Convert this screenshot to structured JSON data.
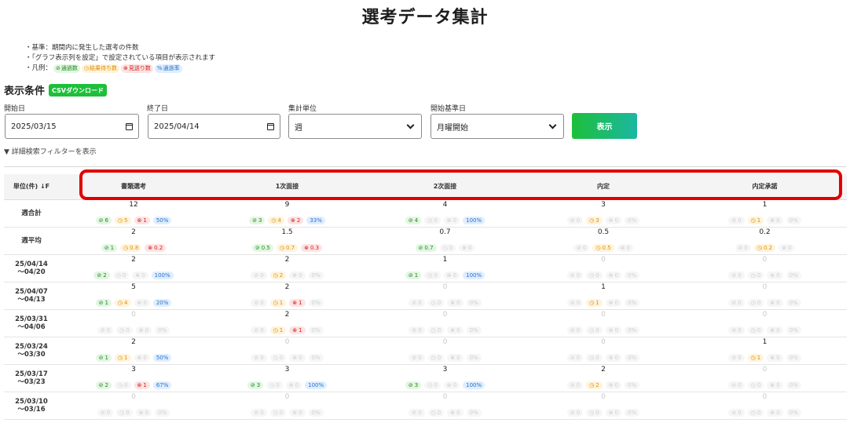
{
  "title": "選考データ集計",
  "notes": {
    "line1": "・基準：期間内に発生した選考の件数",
    "line2": "・「グラフ表示列を設定」で設定されている項目が表示されます",
    "legend_prefix": "・凡例：",
    "legend": [
      {
        "icon": "⊘",
        "label": "通過数",
        "kind": "g"
      },
      {
        "icon": "◷",
        "label": "結果待ち数",
        "kind": "o"
      },
      {
        "icon": "⊗",
        "label": "見送り数",
        "kind": "r"
      },
      {
        "icon": "%",
        "label": "通過率",
        "kind": "b"
      }
    ]
  },
  "conditions": {
    "title": "表示条件",
    "csv_label": "CSVダウンロード",
    "start_label": "開始日",
    "start_value": "2025/03/15",
    "end_label": "終了日",
    "end_value": "2025/04/14",
    "unit_label": "集計単位",
    "unit_value": "週",
    "base_label": "開始基準日",
    "base_value": "月曜開始",
    "show_label": "表示",
    "filter_toggle": "▼ 詳細検索フィルターを表示"
  },
  "table": {
    "corner_label": "単位(件)",
    "sort_icon": "↓F",
    "columns": [
      "書類選考",
      "1次面接",
      "2次面接",
      "内定",
      "内定承諾"
    ],
    "rows": [
      {
        "label1": "週合計",
        "label2": "",
        "cells": [
          {
            "v": "12",
            "p": "6",
            "w": "5",
            "f": "1",
            "r": "50%"
          },
          {
            "v": "9",
            "p": "3",
            "w": "4",
            "f": "2",
            "r": "33%"
          },
          {
            "v": "4",
            "p": "4",
            "w": "0",
            "f": "0",
            "r": "100%"
          },
          {
            "v": "3",
            "p": "0",
            "w": "3",
            "f": "0",
            "r": "0%"
          },
          {
            "v": "1",
            "p": "0",
            "w": "1",
            "f": "0",
            "r": "0%"
          }
        ]
      },
      {
        "label1": "週平均",
        "label2": "",
        "cells": [
          {
            "v": "2",
            "p": "1",
            "w": "0.8",
            "f": "0.2",
            "r": ""
          },
          {
            "v": "1.5",
            "p": "0.5",
            "w": "0.7",
            "f": "0.3",
            "r": ""
          },
          {
            "v": "0.7",
            "p": "0.7",
            "w": "0",
            "f": "0",
            "r": ""
          },
          {
            "v": "0.5",
            "p": "0",
            "w": "0.5",
            "f": "0",
            "r": ""
          },
          {
            "v": "0.2",
            "p": "0",
            "w": "0.2",
            "f": "0",
            "r": ""
          }
        ]
      },
      {
        "label1": "25/04/14",
        "label2": "〜04/20",
        "cells": [
          {
            "v": "2",
            "p": "2",
            "w": "0",
            "f": "0",
            "r": "100%"
          },
          {
            "v": "2",
            "p": "0",
            "w": "2",
            "f": "0",
            "r": "0%"
          },
          {
            "v": "1",
            "p": "1",
            "w": "0",
            "f": "0",
            "r": "100%"
          },
          {
            "v": "0",
            "p": "0",
            "w": "0",
            "f": "0",
            "r": "0%"
          },
          {
            "v": "0",
            "p": "0",
            "w": "0",
            "f": "0",
            "r": "0%"
          }
        ]
      },
      {
        "label1": "25/04/07",
        "label2": "〜04/13",
        "cells": [
          {
            "v": "5",
            "p": "1",
            "w": "4",
            "f": "0",
            "r": "20%"
          },
          {
            "v": "2",
            "p": "0",
            "w": "1",
            "f": "1",
            "r": "0%"
          },
          {
            "v": "0",
            "p": "0",
            "w": "0",
            "f": "0",
            "r": "0%"
          },
          {
            "v": "1",
            "p": "0",
            "w": "1",
            "f": "0",
            "r": "0%"
          },
          {
            "v": "0",
            "p": "0",
            "w": "0",
            "f": "0",
            "r": "0%"
          }
        ]
      },
      {
        "label1": "25/03/31",
        "label2": "〜04/06",
        "cells": [
          {
            "v": "0",
            "p": "0",
            "w": "0",
            "f": "0",
            "r": "0%"
          },
          {
            "v": "2",
            "p": "0",
            "w": "1",
            "f": "1",
            "r": "0%"
          },
          {
            "v": "0",
            "p": "0",
            "w": "0",
            "f": "0",
            "r": "0%"
          },
          {
            "v": "0",
            "p": "0",
            "w": "0",
            "f": "0",
            "r": "0%"
          },
          {
            "v": "0",
            "p": "0",
            "w": "0",
            "f": "0",
            "r": "0%"
          }
        ]
      },
      {
        "label1": "25/03/24",
        "label2": "〜03/30",
        "cells": [
          {
            "v": "2",
            "p": "1",
            "w": "1",
            "f": "0",
            "r": "50%"
          },
          {
            "v": "0",
            "p": "0",
            "w": "0",
            "f": "0",
            "r": "0%"
          },
          {
            "v": "0",
            "p": "0",
            "w": "0",
            "f": "0",
            "r": "0%"
          },
          {
            "v": "0",
            "p": "0",
            "w": "0",
            "f": "0",
            "r": "0%"
          },
          {
            "v": "1",
            "p": "0",
            "w": "1",
            "f": "0",
            "r": "0%"
          }
        ]
      },
      {
        "label1": "25/03/17",
        "label2": "〜03/23",
        "cells": [
          {
            "v": "3",
            "p": "2",
            "w": "0",
            "f": "1",
            "r": "67%"
          },
          {
            "v": "3",
            "p": "3",
            "w": "0",
            "f": "0",
            "r": "100%"
          },
          {
            "v": "3",
            "p": "3",
            "w": "0",
            "f": "0",
            "r": "100%"
          },
          {
            "v": "2",
            "p": "0",
            "w": "2",
            "f": "0",
            "r": "0%"
          },
          {
            "v": "0",
            "p": "0",
            "w": "0",
            "f": "0",
            "r": "0%"
          }
        ]
      },
      {
        "label1": "25/03/10",
        "label2": "〜03/16",
        "cells": [
          {
            "v": "0",
            "p": "0",
            "w": "0",
            "f": "0",
            "r": "0%"
          },
          {
            "v": "0",
            "p": "0",
            "w": "0",
            "f": "0",
            "r": "0%"
          },
          {
            "v": "0",
            "p": "0",
            "w": "0",
            "f": "0",
            "r": "0%"
          },
          {
            "v": "0",
            "p": "0",
            "w": "0",
            "f": "0",
            "r": "0%"
          },
          {
            "v": "0",
            "p": "0",
            "w": "0",
            "f": "0",
            "r": "0%"
          }
        ]
      }
    ]
  },
  "icons": {
    "pass": "⊘",
    "wait": "◷",
    "fail": "⊗",
    "rate": "%"
  },
  "colors": {
    "accent": "#1dbf3a",
    "highlight": "#e00000",
    "pass": "#1d8a1d",
    "wait": "#d99000",
    "fail": "#d12020",
    "rate": "#2a70c8"
  }
}
